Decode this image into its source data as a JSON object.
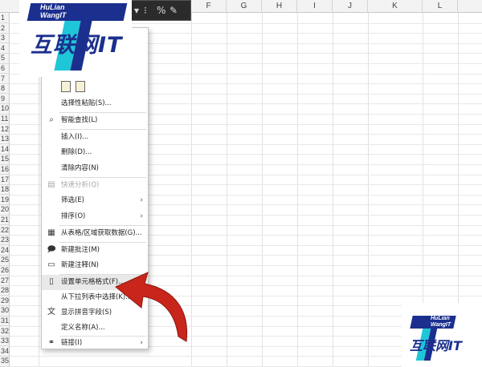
{
  "sheet": {
    "columns": [
      "F",
      "G",
      "H",
      "I",
      "J",
      "K",
      "L"
    ],
    "rows": [
      "1",
      "2",
      "3",
      "4",
      "5",
      "6",
      "7",
      "8",
      "9",
      "10",
      "11",
      "12",
      "13",
      "14",
      "15",
      "16",
      "17",
      "18",
      "19",
      "20",
      "21",
      "22",
      "23",
      "24",
      "25",
      "26",
      "27",
      "28",
      "29",
      "30",
      "31",
      "32",
      "33",
      "34",
      "35"
    ]
  },
  "logo": {
    "line1": "HuLian",
    "line2": "WangIT",
    "text": "互联网IT",
    "colors": {
      "navy": "#1b2f8e",
      "cyan": "#1fc6d8"
    }
  },
  "menu": {
    "paste_special": "选择性粘贴(S)...",
    "smart_lookup": "智能查找(L)",
    "insert": "插入(I)...",
    "delete": "删除(D)...",
    "clear_contents": "清除内容(N)",
    "quick_analysis": "快速分析(Q)",
    "filter": "筛选(E)",
    "sort": "排序(O)",
    "get_data_from_table": "从表格/区域获取数据(G)...",
    "new_comment": "新建批注(M)",
    "new_note": "新建注释(N)",
    "format_cells": "设置单元格格式(F)...",
    "pick_from_dropdown": "从下拉列表中选择(K)...",
    "show_phonetic": "显示拼音字段(S)",
    "define_name": "定义名称(A)...",
    "link": "链接(I)"
  },
  "icons": {
    "paste_format": "paste-format-icon",
    "paste_clipboard": "clipboard-icon",
    "search": "search-icon",
    "quick_analysis": "quick-analysis-icon",
    "table": "table-icon",
    "new_comment": "comment-icon",
    "new_note": "note-icon",
    "format_cells": "format-cells-icon",
    "phonetic": "phonetic-icon",
    "link": "link-icon",
    "arrow": "red-arrow-icon"
  },
  "colors": {
    "arrow_red": "#c8261a",
    "menu_highlight": "#e9e9e9"
  }
}
